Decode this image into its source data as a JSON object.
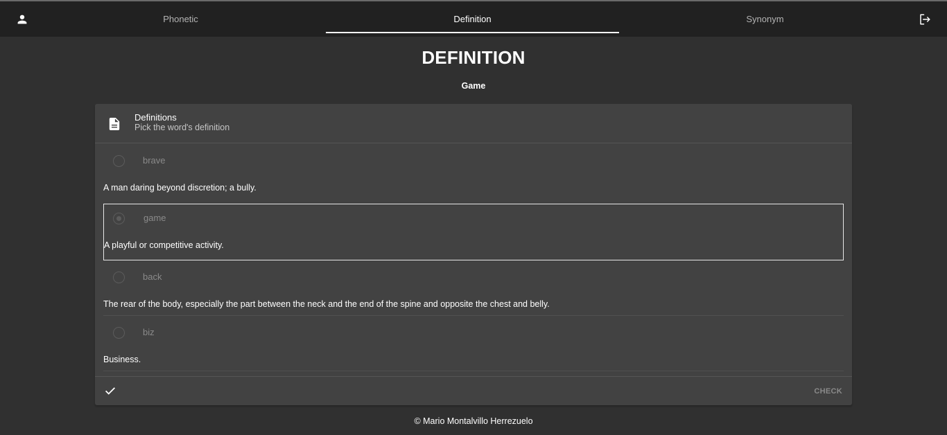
{
  "nav": {
    "tabs": [
      {
        "label": "Phonetic",
        "active": false
      },
      {
        "label": "Definition",
        "active": true
      },
      {
        "label": "Synonym",
        "active": false
      }
    ],
    "left_icon": "account-icon",
    "right_icon": "logout-icon"
  },
  "page": {
    "title": "DEFINITION",
    "word": "Game"
  },
  "card": {
    "header_icon": "document-icon",
    "title": "Definitions",
    "subtitle": "Pick the word's definition",
    "options": [
      {
        "word": "brave",
        "definition": "A man daring beyond discretion; a bully.",
        "selected": false
      },
      {
        "word": "game",
        "definition": "A playful or competitive activity.",
        "selected": true
      },
      {
        "word": "back",
        "definition": "The rear of the body, especially the part between the neck and the end of the spine and opposite the chest and belly.",
        "selected": false
      },
      {
        "word": "biz",
        "definition": "Business.",
        "selected": false
      }
    ],
    "action_icon": "check-icon",
    "check_label": "CHECK"
  },
  "footer": {
    "text": "© Mario Montalvillo Herrezuelo"
  },
  "colors": {
    "background": "#303030",
    "appbar": "#212121",
    "card": "#424242",
    "text": "#ffffff",
    "muted": "#8a8a8a"
  }
}
